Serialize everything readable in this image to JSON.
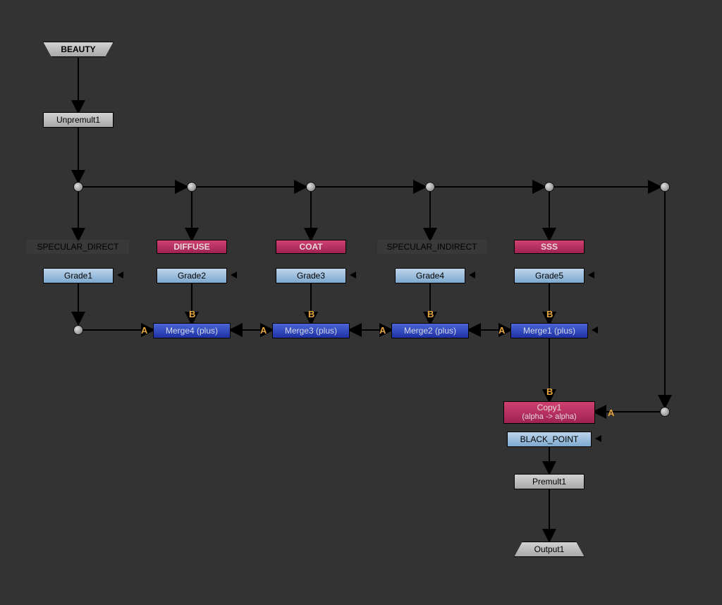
{
  "nodes": {
    "beauty": "BEAUTY",
    "unpremult1": "Unpremult1",
    "diffuse": "DIFFUSE",
    "coat": "COAT",
    "sss": "SSS",
    "grade1": "Grade1",
    "grade2": "Grade2",
    "grade3": "Grade3",
    "grade4": "Grade4",
    "grade5": "Grade5",
    "merge4": "Merge4 (plus)",
    "merge3": "Merge3 (plus)",
    "merge2": "Merge2 (plus)",
    "merge1": "Merge1 (plus)",
    "copy1_line1": "Copy1",
    "copy1_line2": "(alpha -> alpha)",
    "black_point": "BLACK_POINT",
    "premult1": "Premult1",
    "output1": "Output1"
  },
  "backdrops": {
    "specular_direct": "SPECULAR_DIRECT",
    "specular_indirect": "SPECULAR_INDIRECT"
  },
  "ports": {
    "A": "A",
    "B": "B"
  }
}
